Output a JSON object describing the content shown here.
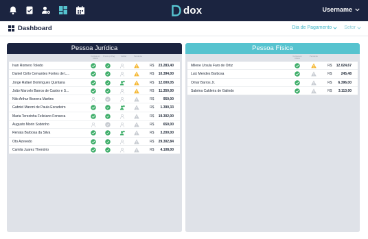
{
  "header": {
    "logo_text": "dox",
    "user_name": "Username",
    "icons": [
      "bell-icon",
      "document-check-icon",
      "users-settings-icon",
      "dashboard-grid-icon",
      "calendar-icon"
    ]
  },
  "subheader": {
    "title": "Dashboard",
    "filter_payment": "Dia de Pagamento",
    "filter_sector": "Setor"
  },
  "colors": {
    "navy": "#1b2440",
    "teal": "#56c3cf",
    "green": "#3fae6a",
    "warning": "#f5b731",
    "grey_icon": "#c7cbd1"
  },
  "pj": {
    "title": "Pessoa Jurídica",
    "columns": [
      "Contas em Atraso",
      "Pronto p/ Pag.",
      "Validar",
      "Pendente"
    ],
    "currency": "R$",
    "rows": [
      {
        "name": "Ivan Romero Toledo",
        "c1": "ok",
        "c2": "badge",
        "c3": "grey",
        "c4": "warn",
        "amount": "23.283,40"
      },
      {
        "name": "Daniel Cirilo Cervantes Fontes de L...",
        "c1": "ok",
        "c2": "badge",
        "c3": "grey",
        "c4": "warn",
        "amount": "10.394,00"
      },
      {
        "name": "Jorge Rafael Domingues Quintana",
        "c1": "ok",
        "c2": "badge",
        "c3": "person",
        "c4": "warn",
        "amount": "12.000,05"
      },
      {
        "name": "João Marcelo Barros de Castro e S...",
        "c1": "ok",
        "c2": "badge",
        "c3": "grey",
        "c4": "warn",
        "amount": "11.350,00"
      },
      {
        "name": "Nilo Arthur Bezerra Martins",
        "c1": "grey",
        "c2": "greybadge",
        "c3": "grey",
        "c4": "greywarn",
        "amount": "950,00"
      },
      {
        "name": "Gabriel Maroni de Paula Escudeiro",
        "c1": "ok",
        "c2": "badge",
        "c3": "person",
        "c4": "greywarn",
        "amount": "1.390,33"
      },
      {
        "name": "Maria Terezinha Feliciano Fonseca",
        "c1": "ok",
        "c2": "badge",
        "c3": "grey",
        "c4": "greywarn",
        "amount": "19.302,00"
      },
      {
        "name": "Augusto Morin Sobrinho",
        "c1": "grey",
        "c2": "greybadge",
        "c3": "grey",
        "c4": "greywarn",
        "amount": "650,00"
      },
      {
        "name": "Renata Barbosa da Silva",
        "c1": "ok",
        "c2": "badge",
        "c3": "person",
        "c4": "greywarn",
        "amount": "3.200,00"
      },
      {
        "name": "Oto Azevedo",
        "c1": "ok",
        "c2": "badge",
        "c3": "grey",
        "c4": "greywarn",
        "amount": "29.302,84"
      },
      {
        "name": "Camila Juarez Thenório",
        "c1": "ok",
        "c2": "badge",
        "c3": "grey",
        "c4": "greywarn",
        "amount": "4.108,00"
      }
    ]
  },
  "pf": {
    "title": "Pessoa Física",
    "columns": [
      "Contas em Atraso",
      "Pendente"
    ],
    "currency": "R$",
    "rows": [
      {
        "name": "Milene Úrsula Faro de Ortiz",
        "c1": "ok",
        "c4": "warn",
        "amount": "12.024,67"
      },
      {
        "name": "Luiz Mendes Barbosa",
        "c1": "ok",
        "c4": "greywarn",
        "amount": "245,48"
      },
      {
        "name": "Omar Barros Jr.",
        "c1": "ok",
        "c4": "greywarn",
        "amount": "6.396,00"
      },
      {
        "name": "Sabrina Caldeira de Galindo",
        "c1": "ok",
        "c4": "greywarn",
        "amount": "3.113,00"
      }
    ]
  }
}
